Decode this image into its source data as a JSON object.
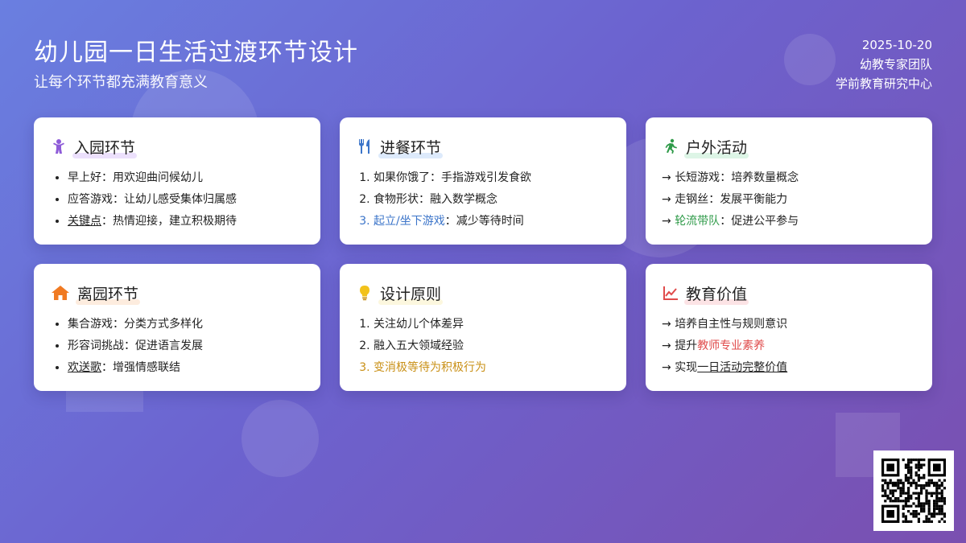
{
  "header": {
    "title": "幼儿园一日生活过渡环节设计",
    "subtitle": "让每个环节都充满教育意义",
    "date": "2025-10-20",
    "team": "幼教专家团队",
    "org": "学前教育研究中心"
  },
  "cards": {
    "arrival": {
      "icon": "child-icon",
      "title": "入园环节",
      "items": [
        {
          "k": "早上好",
          "sep": "：",
          "v": "用欢迎曲问候幼儿"
        },
        {
          "k": "应答游戏",
          "sep": "：",
          "v": "让幼儿感受集体归属感"
        },
        {
          "k": "关键点",
          "sep": "：",
          "v": "热情迎接，建立积极期待"
        }
      ]
    },
    "meal": {
      "icon": "fork-knife-icon",
      "title": "进餐环节",
      "items": [
        {
          "k": "如果你饿了",
          "sep": "：",
          "v": "手指游戏引发食欲"
        },
        {
          "k": "食物形状",
          "sep": "：",
          "v": "融入数学概念"
        },
        {
          "k": "起立/坐下游戏",
          "sep": "：",
          "v": "减少等待时间"
        }
      ]
    },
    "outdoor": {
      "icon": "running-icon",
      "title": "户外活动",
      "items": [
        {
          "k": "长短游戏",
          "sep": "：",
          "v": "培养数量概念"
        },
        {
          "k": "走钢丝",
          "sep": "：",
          "v": "发展平衡能力"
        },
        {
          "k": "轮流带队",
          "sep": "：",
          "v": "促进公平参与"
        }
      ]
    },
    "departure": {
      "icon": "house-icon",
      "title": "离园环节",
      "items": [
        {
          "k": "集合游戏",
          "sep": "：",
          "v": "分类方式多样化"
        },
        {
          "k": "形容词挑战",
          "sep": "：",
          "v": "促进语言发展"
        },
        {
          "k": "欢送歌",
          "sep": "：",
          "v": "增强情感联结"
        }
      ]
    },
    "principles": {
      "icon": "lightbulb-icon",
      "title": "设计原则",
      "items": [
        "关注幼儿个体差异",
        "融入五大领域经验",
        "变消极等待为积极行为"
      ]
    },
    "value": {
      "icon": "chart-line-icon",
      "title": "教育价值",
      "items": [
        {
          "a": "培养自主性与规则意识",
          "b": ""
        },
        {
          "a": "提升",
          "b": "教师专业素养"
        },
        {
          "a": "实现",
          "b": "一日活动完整价值"
        }
      ]
    }
  },
  "colors": {
    "bg_start": "#6a7fe0",
    "bg_end": "#7a4fb0",
    "purple": "#8e5bd8",
    "blue": "#3b74c9",
    "green": "#2e9a48",
    "orange": "#f07a22",
    "gold": "#c99016",
    "red": "#e04b4b"
  },
  "qr": {
    "icon": "qr-code-icon"
  }
}
